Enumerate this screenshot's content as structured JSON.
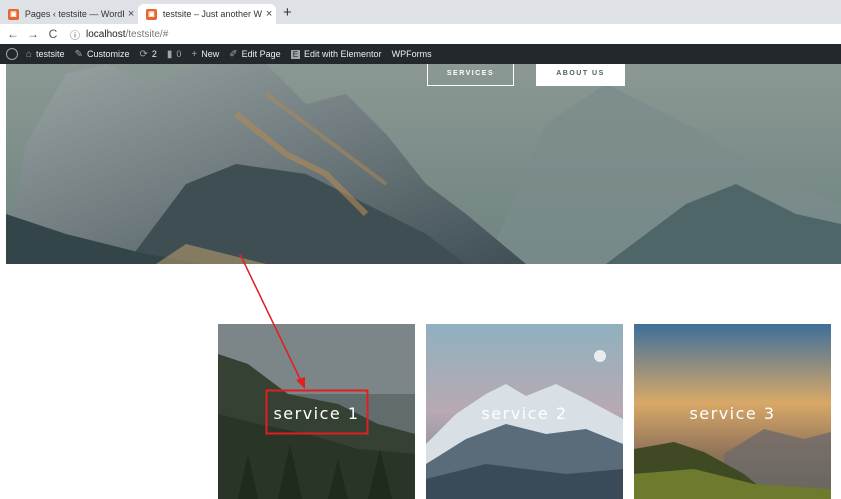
{
  "browser": {
    "tabs": [
      {
        "title": "Pages ‹ testsite — WordPress",
        "close": "×",
        "favicon": "▣"
      },
      {
        "title": "testsite – Just another WordPress",
        "close": "×",
        "favicon": "▣"
      }
    ],
    "new_tab": "+",
    "nav": {
      "back": "←",
      "forward": "→",
      "reload": "C"
    },
    "info_icon": "ⓘ",
    "url_host": "localhost",
    "url_path": "/testsite/#"
  },
  "wp_admin_bar": {
    "site_name": "testsite",
    "customize": "Customize",
    "updates_count": "2",
    "comments_count": "0",
    "new": "New",
    "edit_page": "Edit Page",
    "edit_elementor": "Edit with Elementor",
    "wpforms": "WPForms"
  },
  "hero": {
    "services_button": "SERVICES",
    "about_button": "ABOUT US"
  },
  "services": [
    {
      "label": "service 1"
    },
    {
      "label": "service 2"
    },
    {
      "label": "service 3"
    }
  ],
  "colors": {
    "annotation": "#e02020",
    "wp_bar": "#23282d",
    "tab_strip": "#dee1e6"
  }
}
